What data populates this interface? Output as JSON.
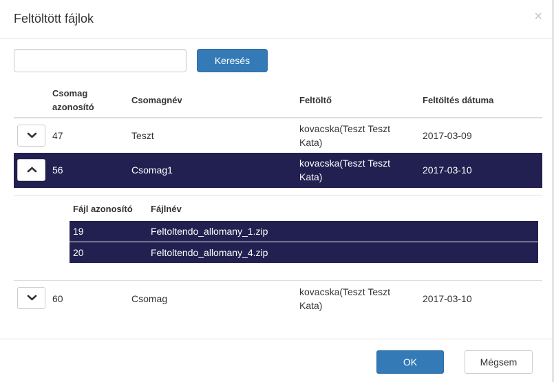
{
  "modal": {
    "title": "Feltöltött fájlok",
    "close_symbol": "×"
  },
  "search": {
    "value": "",
    "placeholder": "",
    "button_label": "Keresés"
  },
  "packages_table": {
    "columns": {
      "id_line1": "Csomag",
      "id_line2": "azonosító",
      "name": "Csomagnév",
      "uploader": "Feltöltő",
      "date": "Feltöltés dátuma"
    },
    "rows": [
      {
        "id": "47",
        "name": "Teszt",
        "uploader_line1": "kovacska(Teszt Teszt",
        "uploader_line2": "Kata)",
        "date": "2017-03-09",
        "expanded": false,
        "toggle_icon": "chevron-down-icon"
      },
      {
        "id": "56",
        "name": "Csomag1",
        "uploader_line1": "kovacska(Teszt Teszt",
        "uploader_line2": "Kata)",
        "date": "2017-03-10",
        "expanded": true,
        "toggle_icon": "chevron-up-icon"
      },
      {
        "id": "60",
        "name": "Csomag",
        "uploader_line1": "kovacska(Teszt Teszt",
        "uploader_line2": "Kata)",
        "date": "2017-03-10",
        "expanded": false,
        "toggle_icon": "chevron-down-icon"
      }
    ]
  },
  "files_table": {
    "columns": {
      "file_id": "Fájl azonosító",
      "file_name": "Fájlnév"
    },
    "rows": [
      {
        "id": "19",
        "name": "Feltoltendo_allomany_1.zip"
      },
      {
        "id": "20",
        "name": "Feltoltendo_allomany_4.zip"
      }
    ]
  },
  "footer": {
    "ok_label": "OK",
    "cancel_label": "Mégsem"
  },
  "colors": {
    "primary": "#337ab7",
    "selected_row": "#222050",
    "border": "#dddddd"
  }
}
